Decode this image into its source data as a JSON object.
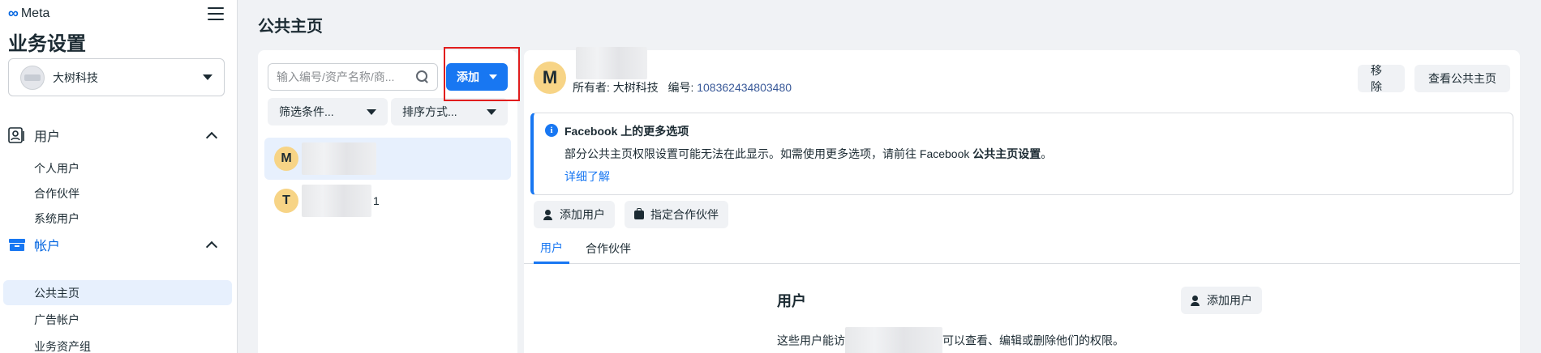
{
  "brand": {
    "name": "Meta",
    "logo_glyph": "∞"
  },
  "sidebar": {
    "title": "业务设置",
    "business_name": "大树科技",
    "sections": [
      {
        "label": "用户",
        "icon": "users-icon",
        "items": [
          "个人用户",
          "合作伙伴",
          "系统用户"
        ]
      },
      {
        "label": "帐户",
        "icon": "accounts-icon",
        "items": [
          "公共主页",
          "广告帐户",
          "业务资产组"
        ]
      }
    ],
    "selected_item": "公共主页"
  },
  "main": {
    "title": "公共主页",
    "search": {
      "placeholder": "输入编号/资产名称/商..."
    },
    "add_button": "添加",
    "filter_label": "筛选条件...",
    "sort_label": "排序方式...",
    "list_items": [
      {
        "initial": "M",
        "suffix": ""
      },
      {
        "initial": "T",
        "suffix": "1"
      }
    ]
  },
  "detail": {
    "avatar_initial": "M",
    "owner_label": "所有者:",
    "owner_name": "大树科技",
    "id_label": "编号:",
    "id_value": "108362434803480",
    "remove_button": "移除",
    "view_button": "查看公共主页",
    "notice": {
      "title": "Facebook 上的更多选项",
      "body_prefix": "部分公共主页权限设置可能无法在此显示。如需使用更多选项，请前往 Facebook ",
      "body_bold": "公共主页设置",
      "body_suffix": "。",
      "link": "详细了解"
    },
    "add_user_button": "添加用户",
    "assign_partner_button": "指定合作伙伴",
    "tabs": [
      "用户",
      "合作伙伴"
    ],
    "active_tab": "用户",
    "users_section": {
      "title": "用户",
      "add_user_button": "添加用户",
      "desc_prefix": "这些用户能访",
      "desc_suffix": "可以查看、编辑或删除他们的权限。"
    }
  },
  "colors": {
    "accent": "#1877f2",
    "highlight": "#e11d1d",
    "avatar": "#f7d486",
    "selected_bg": "#e7f0fd"
  }
}
